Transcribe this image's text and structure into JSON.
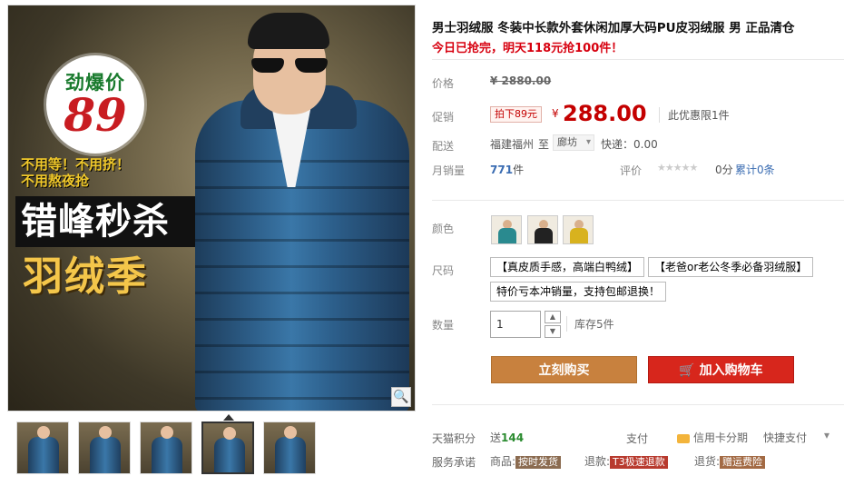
{
  "gallery": {
    "promo": {
      "price_label": "劲爆价",
      "price": "89",
      "sub_lines": [
        "不用等！不用挤！",
        "不用熬夜抢"
      ],
      "banner_black": "错峰秒杀",
      "banner_yellow": "羽绒季"
    },
    "zoom_icon": "🔍",
    "thumbnail_count": 5,
    "selected_thumbnail": 4
  },
  "product": {
    "title": "男士羽绒服 冬装中长款外套休闲加厚大码PU皮羽绒服 男 正品清仓",
    "subtitle": "今日已抢完，明天118元抢100件！"
  },
  "meta": {
    "price_label": "价格",
    "original_price": "¥ 2880.00",
    "promo_label": "促销",
    "promo_tag": "拍下89元",
    "currency": "¥",
    "promo_price": "288.00",
    "limit_text": "此优惠限1件",
    "ship_label": "配送",
    "ship_from": "福建福州",
    "ship_to_text": "至",
    "ship_to": "廊坊",
    "ship_fee": "快递：0.00",
    "sales_label": "月销量",
    "sales_count": "771",
    "sales_unit": "件",
    "rating_label": "评价",
    "stars": "★★★★★",
    "rating_score": "0分",
    "rating_total": "累计0条"
  },
  "options": {
    "color_label": "颜色",
    "size_label": "尺码",
    "sizes": [
      "【真皮质手感，高端白鸭绒】",
      "【老爸or老公冬季必备羽绒服】",
      "特价亏本冲销量，支持包邮退换！"
    ],
    "qty_label": "数量",
    "qty_value": "1",
    "stock": "库存5件"
  },
  "actions": {
    "buy_label": "立刻购买",
    "cart_label": "加入购物车",
    "cart_icon": "🛒"
  },
  "footer": {
    "points_label": "天猫积分",
    "points_prefix": "送",
    "points_value": "144",
    "pay_label": "支付",
    "credit_label": "信用卡分期",
    "quick_pay": "快捷支付",
    "service_label": "服务承诺",
    "goods_label": "商品:",
    "goods_pill": "按时发货",
    "refund_label": "退款:",
    "refund_pill": "T3极速退款",
    "return_label": "退货:",
    "return_pill": "赠运费险"
  }
}
